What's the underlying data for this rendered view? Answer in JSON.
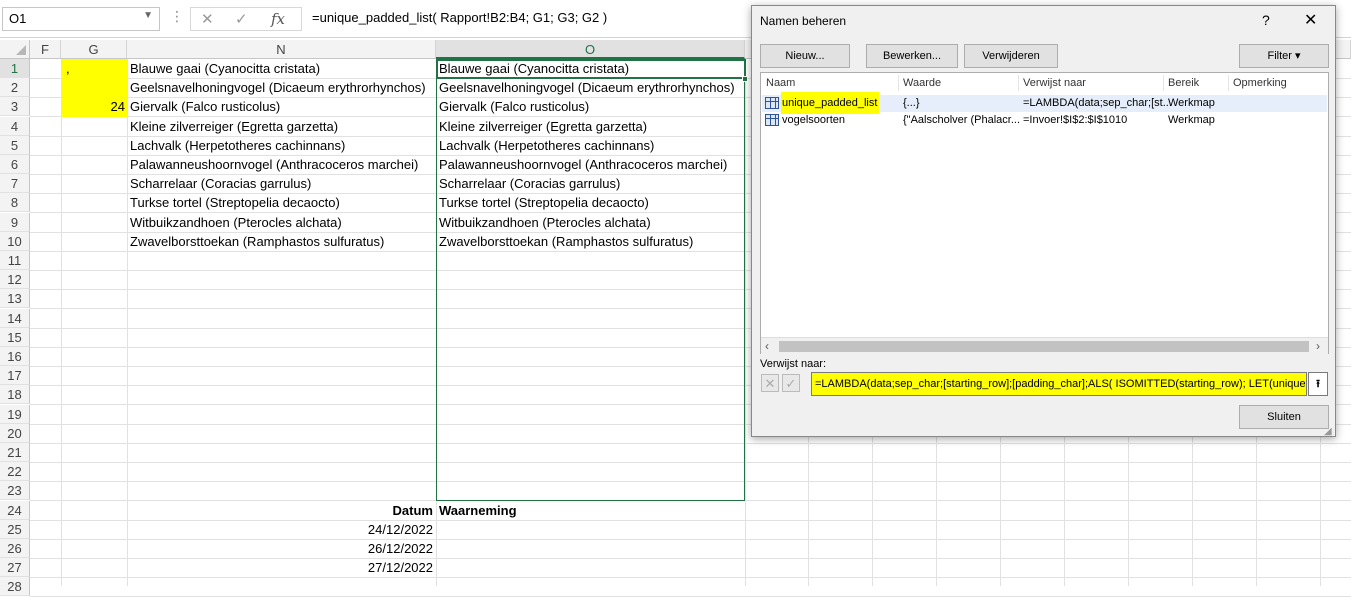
{
  "formula_bar": {
    "name_box": "O1",
    "dots": "⋮",
    "cancel": "✕",
    "enter": "✓",
    "fx": "fx",
    "formula": "=unique_padded_list( Rapport!B2:B4; G1; G3; G2 )"
  },
  "columns": [
    "F",
    "G",
    "N",
    "O"
  ],
  "rows": [
    "1",
    "2",
    "3",
    "4",
    "5",
    "6",
    "7",
    "8",
    "9",
    "10",
    "11",
    "12",
    "13",
    "14",
    "15",
    "16",
    "17",
    "18",
    "19",
    "20",
    "21",
    "22",
    "23",
    "24",
    "25",
    "26",
    "27",
    "28"
  ],
  "col_g": {
    "r1": ",",
    "r3": "24"
  },
  "col_n": [
    "Blauwe gaai (Cyanocitta cristata)",
    "Geelsnavelhoningvogel (Dicaeum erythrorhynchos)",
    "Giervalk (Falco rusticolus)",
    "Kleine zilverreiger (Egretta garzetta)",
    "Lachvalk (Herpetotheres cachinnans)",
    "Palawanneushoornvogel (Anthracoceros marchei)",
    "Scharrelaar (Coracias garrulus)",
    "Turkse tortel (Streptopelia decaocto)",
    "Witbuikzandhoen (Pterocles alchata)",
    "Zwavelborsttoekan (Ramphastos sulfuratus)"
  ],
  "col_o": [
    "Blauwe gaai (Cyanocitta cristata)",
    "Geelsnavelhoningvogel (Dicaeum erythrorhynchos)",
    "Giervalk (Falco rusticolus)",
    "Kleine zilverreiger (Egretta garzetta)",
    "Lachvalk (Herpetotheres cachinnans)",
    "Palawanneushoornvogel (Anthracoceros marchei)",
    "Scharrelaar (Coracias garrulus)",
    "Turkse tortel (Streptopelia decaocto)",
    "Witbuikzandhoen (Pterocles alchata)",
    "Zwavelborsttoekan (Ramphastos sulfuratus)"
  ],
  "table": {
    "header_date": "Datum",
    "header_obs": "Waarneming",
    "dates": [
      "24/12/2022",
      "26/12/2022",
      "27/12/2022"
    ]
  },
  "dialog": {
    "title": "Namen beheren",
    "help": "?",
    "close": "✕",
    "buttons": {
      "new": "Nieuw...",
      "edit": "Bewerken...",
      "delete": "Verwijderen",
      "filter": "Filter ▾"
    },
    "headers": {
      "name": "Naam",
      "value": "Waarde",
      "refers_to": "Verwijst naar",
      "scope": "Bereik",
      "comment": "Opmerking"
    },
    "names": [
      {
        "name": "unique_padded_list",
        "value": "{...}",
        "refers_to": "=LAMBDA(data;sep_char;[st...",
        "scope": "Werkmap"
      },
      {
        "name": "vogelsoorten",
        "value": "{\"Aalscholver (Phalacr...",
        "refers_to": "=Invoer!$I$2:$I$1010",
        "scope": "Werkmap"
      }
    ],
    "refers_label": "Verwijst naar:",
    "refers_value": "=LAMBDA(data;sep_char;[starting_row];[padding_char];ALS( ISOMITTED(starting_row); LET(uniques; SORTE",
    "close_button": "Sluiten",
    "highlight_color": "#ffff00"
  }
}
